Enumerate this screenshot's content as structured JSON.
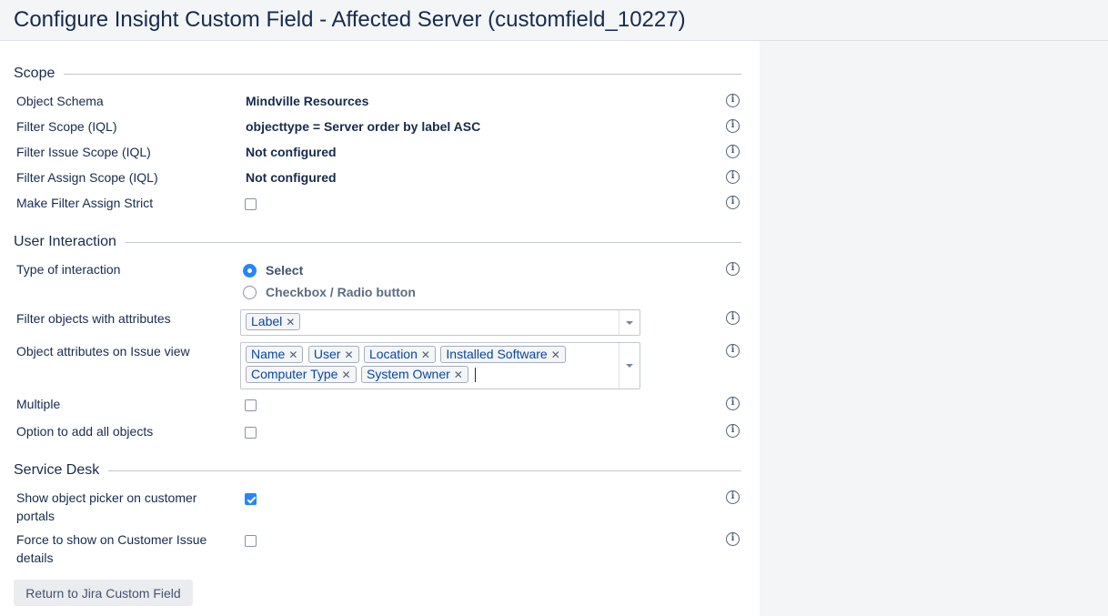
{
  "title": "Configure Insight Custom Field - Affected Server (customfield_10227)",
  "scope": {
    "heading": "Scope",
    "object_schema": {
      "label": "Object Schema",
      "value": "Mindville Resources"
    },
    "filter_scope": {
      "label": "Filter Scope (IQL)",
      "value": "objecttype = Server order by label ASC"
    },
    "filter_issue_scope": {
      "label": "Filter Issue Scope (IQL)",
      "value": "Not configured"
    },
    "filter_assign_scope": {
      "label": "Filter Assign Scope (IQL)",
      "value": "Not configured"
    },
    "make_filter_strict": {
      "label": "Make Filter Assign Strict",
      "checked": false
    }
  },
  "user_interaction": {
    "heading": "User Interaction",
    "type_label": "Type of interaction",
    "options": [
      {
        "label": "Select",
        "selected": true
      },
      {
        "label": "Checkbox / Radio button",
        "selected": false
      }
    ],
    "filter_attrs_label": "Filter objects with attributes",
    "filter_attrs_tags": [
      "Label"
    ],
    "issue_view_label": "Object attributes on Issue view",
    "issue_view_tags": [
      "Name",
      "User",
      "Location",
      "Installed Software",
      "Computer Type",
      "System Owner"
    ],
    "multiple": {
      "label": "Multiple",
      "checked": false
    },
    "add_all": {
      "label": "Option to add all objects",
      "checked": false
    }
  },
  "service_desk": {
    "heading": "Service Desk",
    "show_picker": {
      "label": "Show object picker on customer portals",
      "checked": true
    },
    "force_show": {
      "label": "Force to show on Customer Issue details",
      "checked": false
    }
  },
  "return_button": "Return to Jira Custom Field",
  "icons": {
    "info": "info-icon",
    "tag_remove": "close-icon",
    "dropdown": "chevron-down-icon"
  },
  "colors": {
    "accent": "#2684ff",
    "tag_text": "#0747a6",
    "text": "#172b4d"
  }
}
